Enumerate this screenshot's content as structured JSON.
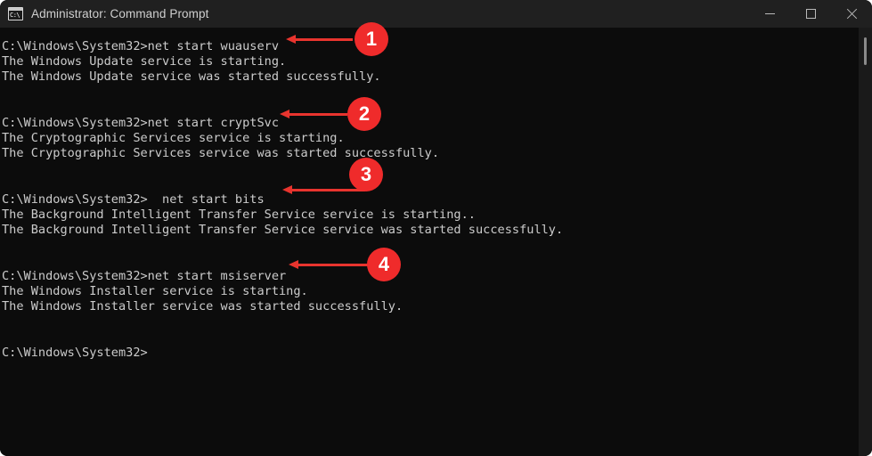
{
  "window": {
    "title": "Administrator: Command Prompt",
    "icon": "command-prompt-icon",
    "icon_glyph": "C:\\",
    "controls": {
      "minimize": "Minimize",
      "maximize": "Maximize",
      "close": "Close"
    },
    "colors": {
      "titlebar_bg": "#202020",
      "console_bg": "#0c0c0c",
      "console_fg": "#cccccc",
      "annotation_red": "#ef2b2b",
      "arrow_red": "#e8342e"
    }
  },
  "console": {
    "text": "C:\\Windows\\System32>net start wuauserv\nThe Windows Update service is starting.\nThe Windows Update service was started successfully.\n\n\nC:\\Windows\\System32>net start cryptSvc\nThe Cryptographic Services service is starting.\nThe Cryptographic Services service was started successfully.\n\n\nC:\\Windows\\System32>  net start bits\nThe Background Intelligent Transfer Service service is starting..\nThe Background Intelligent Transfer Service service was started successfully.\n\n\nC:\\Windows\\System32>net start msiserver\nThe Windows Installer service is starting.\nThe Windows Installer service was started successfully.\n\n\nC:\\Windows\\System32>",
    "lines": [
      "C:\\Windows\\System32>net start wuauserv",
      "The Windows Update service is starting.",
      "The Windows Update service was started successfully.",
      "",
      "",
      "C:\\Windows\\System32>net start cryptSvc",
      "The Cryptographic Services service is starting.",
      "The Cryptographic Services service was started successfully.",
      "",
      "",
      "C:\\Windows\\System32>  net start bits",
      "The Background Intelligent Transfer Service service is starting..",
      "The Background Intelligent Transfer Service service was started successfully.",
      "",
      "",
      "C:\\Windows\\System32>net start msiserver",
      "The Windows Installer service is starting.",
      "The Windows Installer service was started successfully.",
      "",
      "",
      "C:\\Windows\\System32>"
    ]
  },
  "annotations": [
    {
      "label": "1",
      "name": "annotation-badge-1"
    },
    {
      "label": "2",
      "name": "annotation-badge-2"
    },
    {
      "label": "3",
      "name": "annotation-badge-3"
    },
    {
      "label": "4",
      "name": "annotation-badge-4"
    }
  ],
  "scrollbar": {
    "name": "vertical-scrollbar"
  }
}
